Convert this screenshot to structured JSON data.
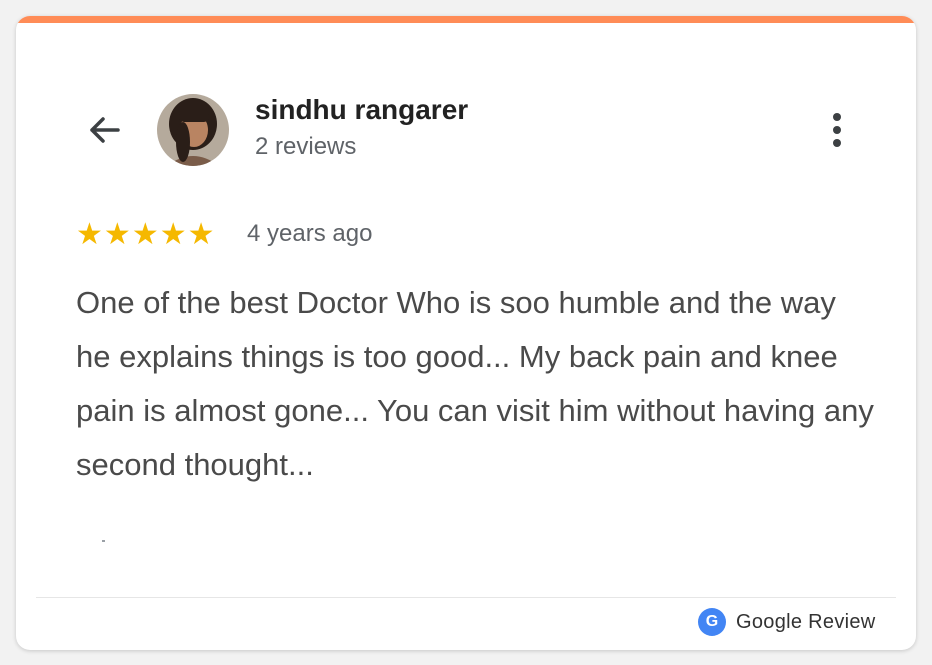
{
  "header": {
    "back_icon": "arrow-left-icon",
    "more_icon": "more-vertical-icon"
  },
  "reviewer": {
    "name": "sindhu rangarer",
    "review_count": "2 reviews"
  },
  "review": {
    "rating": 5,
    "stars": "★★★★★",
    "time": "4 years ago",
    "text": "One of the best Doctor Who is soo humble and the way he explains things is too good... My back pain and knee pain is almost gone... You can visit him without having any second thought..."
  },
  "footer": {
    "google_icon_letter": "G",
    "label": "Google Review"
  },
  "colors": {
    "accent": "#ff8c57",
    "star": "#f5b800",
    "google_blue": "#4285f4"
  }
}
